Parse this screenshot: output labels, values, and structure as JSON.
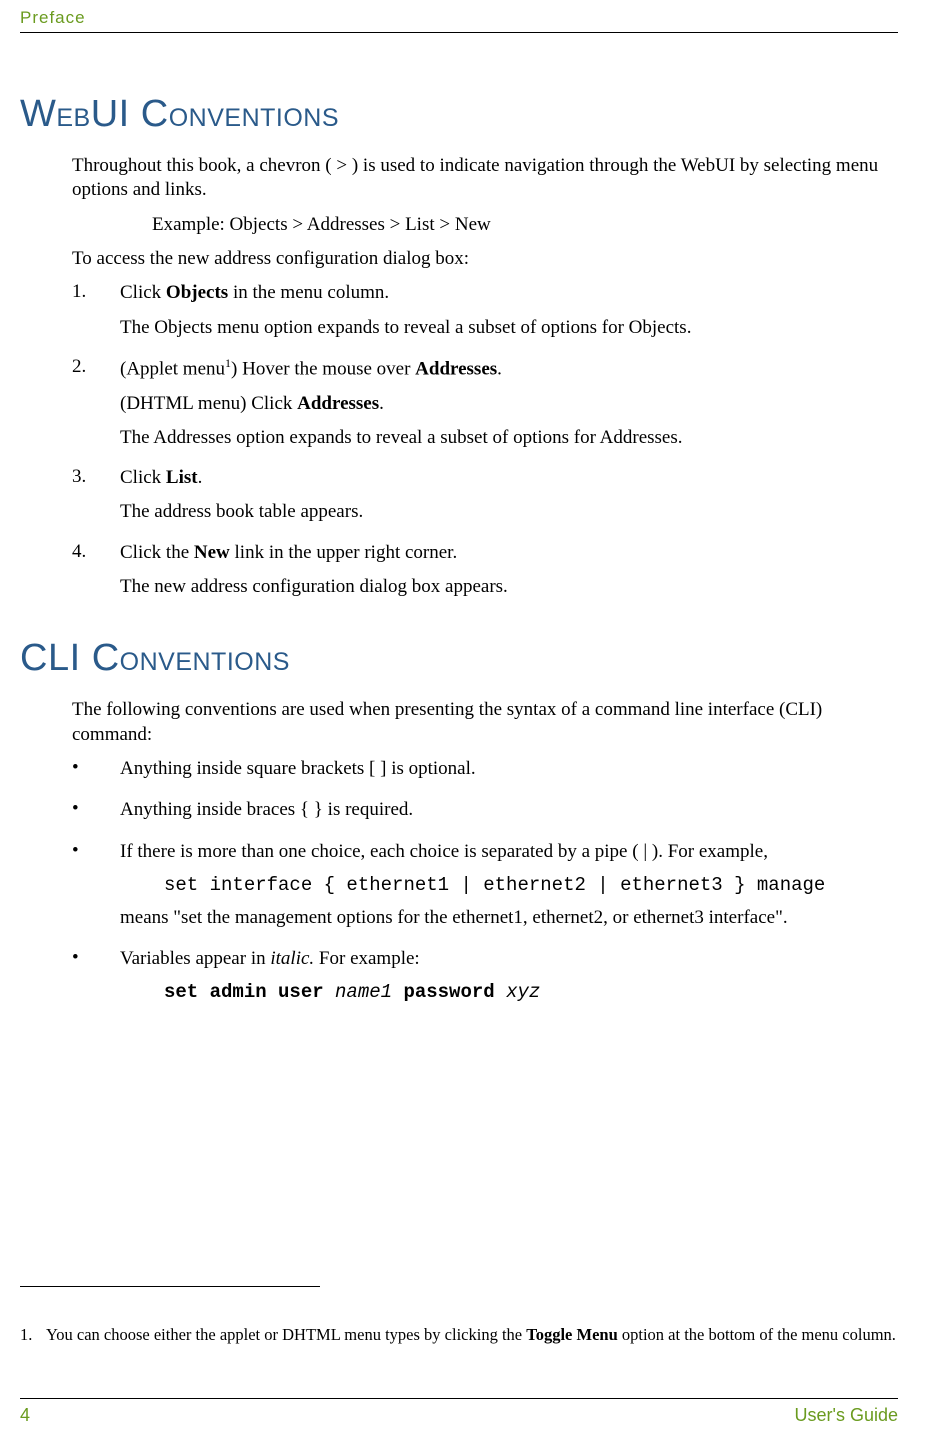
{
  "header": {
    "preface": "Preface"
  },
  "sections": {
    "webui": {
      "heading_cap1": "W",
      "heading_sm1": "EB",
      "heading_cap2": "UI C",
      "heading_sm2": "ONVENTIONS",
      "intro": "Throughout this book, a chevron ( > ) is used to indicate navigation through the WebUI by selecting menu options and links.",
      "example": "Example: Objects > Addresses > List > New",
      "to_access": "To access the new address configuration dialog box:",
      "steps": [
        {
          "num": "1.",
          "l1a": "Click ",
          "l1b": "Objects",
          "l1c": " in the menu column.",
          "l2": "The Objects menu option expands to reveal a subset of options for Objects."
        },
        {
          "num": "2.",
          "l1a": "(Applet menu",
          "sup": "1",
          "l1b": ") Hover the mouse over ",
          "l1c": "Addresses",
          "l1d": ".",
          "l2a": "(DHTML menu) Click ",
          "l2b": "Addresses",
          "l2c": ".",
          "l3": "The Addresses option expands to reveal a subset of options for Addresses."
        },
        {
          "num": "3.",
          "l1a": "Click ",
          "l1b": "List",
          "l1c": ".",
          "l2": "The address book table appears."
        },
        {
          "num": "4.",
          "l1a": "Click the ",
          "l1b": "New",
          "l1c": " link in the upper right corner.",
          "l2": "The new address configuration dialog box appears."
        }
      ]
    },
    "cli": {
      "heading_cap1": "CLI C",
      "heading_sm1": "ONVENTIONS",
      "intro": "The following conventions are used when presenting the syntax of a command line interface (CLI) command:",
      "bullets": {
        "b1": "Anything inside square brackets [ ] is optional.",
        "b2": "Anything inside braces { } is required.",
        "b3a": "If there is more than one choice, each choice is separated by a pipe ( | ). For example,",
        "b3code": "set interface { ethernet1 | ethernet2 | ethernet3 } manage",
        "b3b": "means \"set the management options for the ethernet1, ethernet2, or ethernet3 interface\".",
        "b4a": "Variables appear in ",
        "b4b": "italic.",
        "b4c": " For example:",
        "b4code_bold1": "set admin user ",
        "b4code_it1": "name1",
        "b4code_bold2": " password ",
        "b4code_it2": "xyz"
      }
    }
  },
  "footnote": {
    "num": "1.",
    "text_a": "You can choose either the applet or DHTML menu types by clicking the ",
    "text_b": "Toggle Menu",
    "text_c": " option at the bottom of the menu column."
  },
  "footer": {
    "page": "4",
    "guide": "User's Guide"
  }
}
